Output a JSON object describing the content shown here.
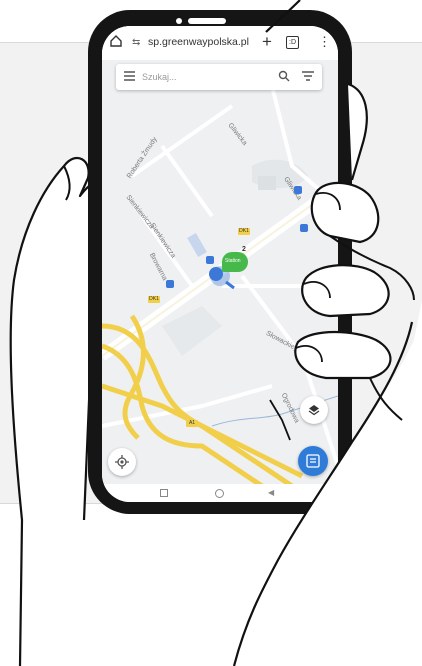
{
  "browser": {
    "url": "sp.greenwaypolska.pl",
    "new_tab": "+",
    "tab_count": ":D",
    "menu": "⋮"
  },
  "search": {
    "placeholder": "Szukaj..."
  },
  "map": {
    "streets": [
      "Gliwicka",
      "Roberta Żmudy",
      "Sienkiewicza",
      "Sienkiewicza",
      "Browarna",
      "Gliwicka",
      "Słowackiego",
      "Ogrodowa"
    ],
    "road_shields": [
      "DK1",
      "DK1",
      "A1"
    ],
    "station_label": "Station",
    "marker_count": "2"
  },
  "colors": {
    "phone": "#151515",
    "map_bg": "#eef0f2",
    "road_yellow": "#f2cf4a",
    "accent_blue": "#2f7bd8",
    "marker_green": "#47b84a"
  }
}
